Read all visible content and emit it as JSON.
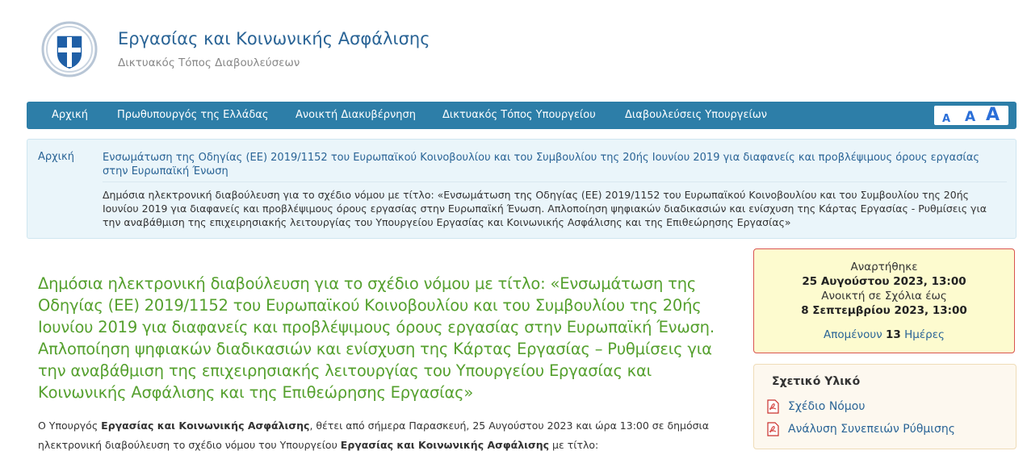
{
  "header": {
    "title": "Εργασίας και Κοινωνικής Ασφάλισης",
    "subtitle": "Δικτυακός Τόπος Διαβουλεύσεων"
  },
  "nav": {
    "items": [
      {
        "label": "Αρχική"
      },
      {
        "label": "Πρωθυπουργός της Ελλάδας"
      },
      {
        "label": "Ανοικτή Διακυβέρνηση"
      },
      {
        "label": "Δικτυακός Τόπος Υπουργείου"
      },
      {
        "label": "Διαβουλεύσεις Υπουργείων"
      }
    ],
    "font_controls": [
      "A",
      "A",
      "A"
    ]
  },
  "breadcrumb": {
    "home": "Αρχική",
    "level1": "Ενσωμάτωση της Οδηγίας (ΕΕ) 2019/1152 του Ευρωπαϊκού Κοινοβουλίου και του Συμβουλίου της 20ής Ιουνίου 2019 για διαφανείς και προβλέψιμους όρους εργασίας στην Ευρωπαϊκή Ένωση",
    "level2": "Δημόσια ηλεκτρονική διαβούλευση για το σχέδιο νόμου με τίτλο: «Ενσωμάτωση της Οδηγίας (ΕΕ) 2019/1152 του Ευρωπαϊκού Κοινοβουλίου και του Συμβουλίου της 20ής Ιουνίου 2019 για διαφανείς και προβλέψιμους όρους εργασίας στην Ευρωπαϊκή Ένωση. Απλοποίηση ψηφιακών διαδικασιών και ενίσχυση της Κάρτας Εργασίας - Ρυθμίσεις για την αναβάθμιση της επιχειρησιακής λειτουργίας του Υπουργείου Εργασίας και Κοινωνικής Ασφάλισης και της Επιθεώρησης Εργασίας»"
  },
  "main": {
    "title": "Δημόσια ηλεκτρονική διαβούλευση για το σχέδιο νόμου με τίτλο: «Ενσωμάτωση της Οδηγίας (ΕΕ) 2019/1152 του Ευρωπαϊκού Κοινοβουλίου και του Συμβουλίου της 20ής Ιουνίου 2019 για διαφανείς και προβλέψιμους όρους εργασίας στην Ευρωπαϊκή Ένωση. Απλοποίηση ψηφιακών διαδικασιών και ενίσχυση της Κάρτας Εργασίας – Ρυθμίσεις για την αναβάθμιση της επιχειρησιακής λειτουργίας του Υπουργείου Εργασίας και Κοινωνικής Ασφάλισης και της Επιθεώρησης Εργασίας»",
    "body_p1_a": "Ο Υπουργός ",
    "body_p1_b": "Εργασίας και Κοινωνικής Ασφάλισης",
    "body_p1_c": ", θέτει από σήμερα Παρασκευή, 25 Αυγούστου 2023 και ώρα 13:00 σε δημόσια ηλεκτρονική διαβούλευση το σχέδιο νόμου του Υπουργείου ",
    "body_p1_d": "Εργασίας και Κοινωνικής Ασφάλισης",
    "body_p1_e": " με τίτλο:"
  },
  "dates": {
    "posted_label": "Αναρτήθηκε",
    "posted_value": "25 Αυγούστου 2023, 13:00",
    "open_label": "Ανοικτή σε Σχόλια έως",
    "open_value": "8 Σεπτεμβρίου 2023, 13:00",
    "remaining_prefix": "Απομένουν",
    "remaining_days": "13",
    "remaining_suffix": "Ημέρες"
  },
  "related": {
    "title": "Σχετικό Υλικό",
    "items": [
      {
        "label": "Σχέδιο Νόμου",
        "icon": "pdf-icon"
      },
      {
        "label": "Ανάλυση Συνεπειών Ρύθμισης",
        "icon": "pdf-icon"
      }
    ]
  },
  "colors": {
    "nav_bg": "#2d7ea8",
    "title_green": "#55a02e",
    "link_blue": "#2a6496",
    "date_box_bg": "#fdfbcf",
    "date_box_border": "#d9534f"
  }
}
